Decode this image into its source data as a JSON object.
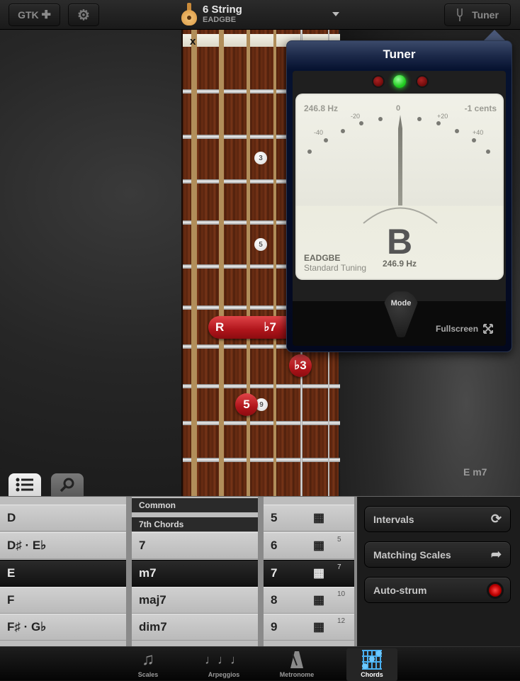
{
  "toolbar": {
    "gtk_label": "GTK",
    "gtk_icon": "plus-icon",
    "settings_icon": "gear-icon",
    "tuner_label": "Tuner",
    "tuner_icon": "tuning-fork-icon"
  },
  "instrument": {
    "title": "6 String",
    "tuning": "EADGBE",
    "icon": "acoustic-guitar-icon"
  },
  "fretboard": {
    "muted_string_mark": "x",
    "inlays": [
      "3",
      "5",
      "9"
    ],
    "chord_dots": {
      "barre_left": "R",
      "barre_right": "♭7",
      "flat3": "♭3",
      "fifth": "5"
    }
  },
  "chord_display": "E m7",
  "tuner": {
    "title": "Tuner",
    "freq_detected": "246.8 Hz",
    "cents": "-1 cents",
    "scale": {
      "zero": "0",
      "m20": "-20",
      "p20": "+20",
      "m40": "-40",
      "p40": "+40"
    },
    "note": "B",
    "note_freq": "246.9 Hz",
    "tuning_name": "EADGBE",
    "tuning_desc": "Standard Tuning",
    "leds": {
      "flat": "off",
      "in_tune": "on",
      "sharp": "off"
    },
    "mode_label": "Mode",
    "fullscreen_label": "Fullscreen"
  },
  "tabs": {
    "list_icon": "list-icon",
    "search_icon": "search-icon"
  },
  "root_list": [
    "D",
    "D♯ · E♭",
    "E",
    "F",
    "F♯ · G♭"
  ],
  "root_selected": "E",
  "type_list": {
    "headers": [
      "Common",
      "7th Chords"
    ],
    "items": [
      "7",
      "m7",
      "maj7",
      "dim7"
    ],
    "selected": "m7"
  },
  "voicing_list": {
    "items": [
      {
        "num": "5",
        "fret": ""
      },
      {
        "num": "6",
        "fret": "5"
      },
      {
        "num": "7",
        "fret": "7"
      },
      {
        "num": "8",
        "fret": "10"
      },
      {
        "num": "9",
        "fret": "12"
      }
    ],
    "next_fret": "12",
    "selected": "7"
  },
  "actions": {
    "intervals": "Intervals",
    "matching_scales": "Matching Scales",
    "auto_strum": "Auto-strum",
    "auto_strum_on": true
  },
  "bottom_tabs": [
    {
      "label": "Scales",
      "icon": "music-note-icon"
    },
    {
      "label": "Arpeggios",
      "icon": "arpeggio-notes-icon"
    },
    {
      "label": "Metronome",
      "icon": "metronome-icon"
    },
    {
      "label": "Chords",
      "icon": "chord-grid-icon",
      "active": true
    }
  ]
}
